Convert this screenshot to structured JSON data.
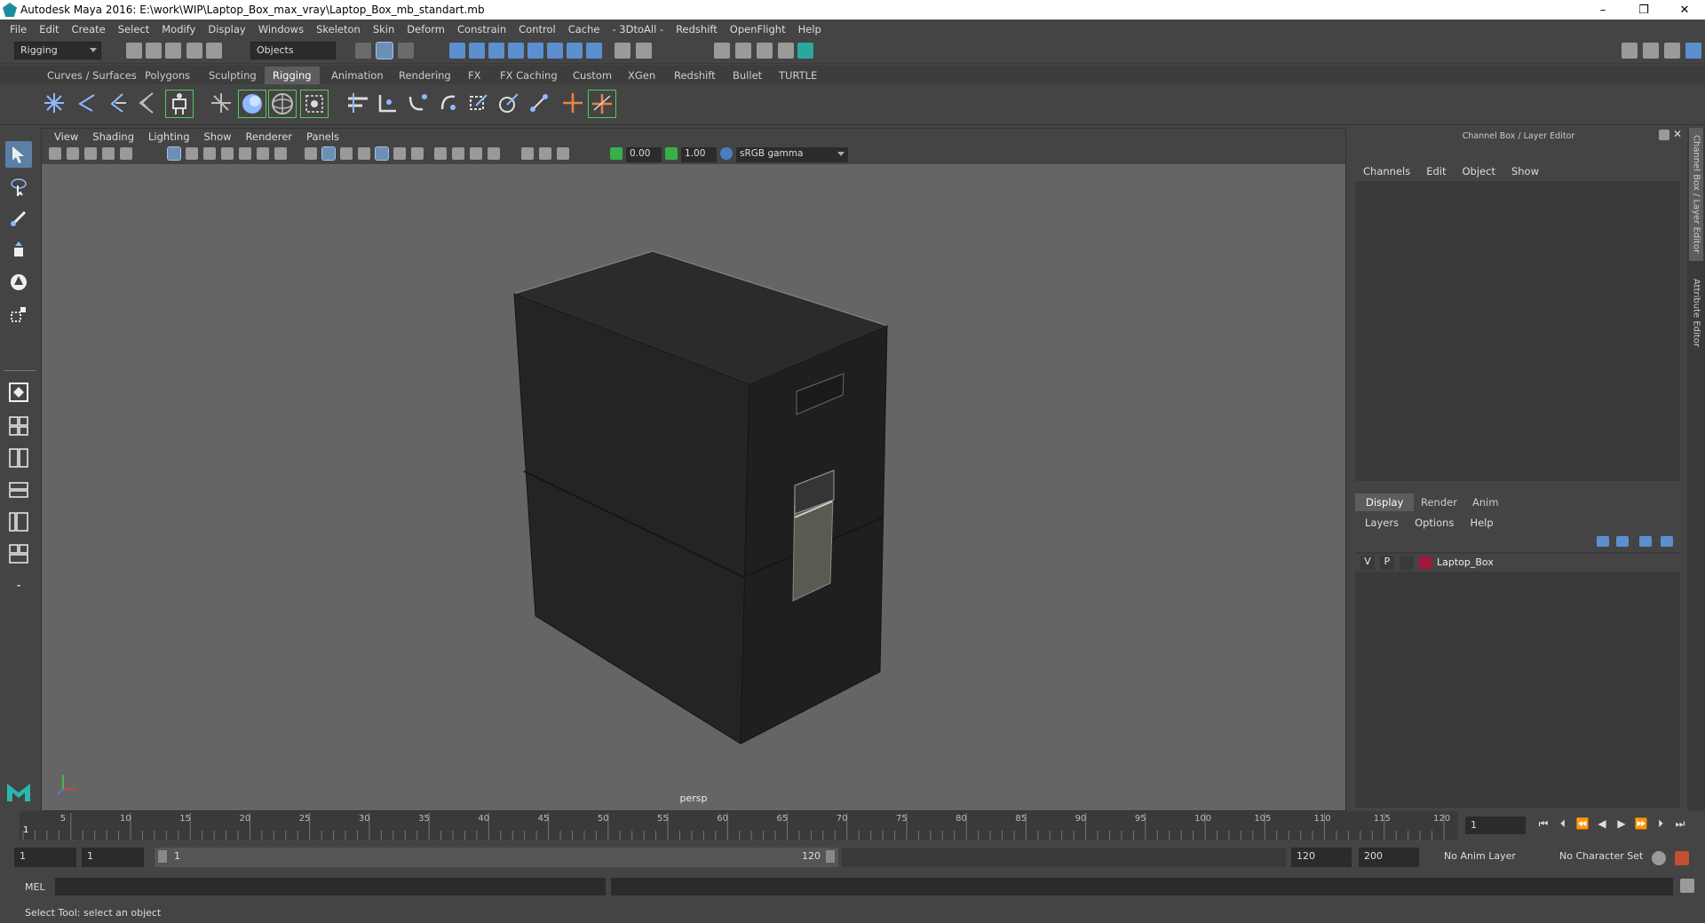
{
  "window": {
    "title": "Autodesk Maya 2016: E:\\work\\WIP\\Laptop_Box_max_vray\\Laptop_Box_mb_standart.mb",
    "controls": [
      "–",
      "❐",
      "✕"
    ]
  },
  "menubar": [
    "File",
    "Edit",
    "Create",
    "Select",
    "Modify",
    "Display",
    "Windows",
    "Skeleton",
    "Skin",
    "Deform",
    "Constrain",
    "Control",
    "Cache",
    "- 3DtoAll -",
    "Redshift",
    "OpenFlight",
    "Help"
  ],
  "statusline": {
    "mode": "Rigging",
    "selection_mode": "Objects"
  },
  "shelf_tabs": [
    "Curves / Surfaces",
    "Polygons",
    "Sculpting",
    "Rigging",
    "Animation",
    "Rendering",
    "FX",
    "FX Caching",
    "Custom",
    "XGen",
    "Redshift",
    "Bullet",
    "TURTLE"
  ],
  "active_shelf_tab": "Rigging",
  "viewport": {
    "menu": [
      "View",
      "Shading",
      "Lighting",
      "Show",
      "Renderer",
      "Panels"
    ],
    "near_value": "0.00",
    "far_value": "1.00",
    "color_space": "sRGB gamma",
    "camera_label": "persp"
  },
  "channel_box": {
    "title": "Channel Box / Layer Editor",
    "menu": [
      "Channels",
      "Edit",
      "Object",
      "Show"
    ],
    "layer_tabs": [
      "Display",
      "Render",
      "Anim"
    ],
    "layer_menu": [
      "Layers",
      "Options",
      "Help"
    ],
    "layer": {
      "v": "V",
      "p": "P",
      "name": "Laptop_Box",
      "color": "#a0173a"
    }
  },
  "side_tabs": [
    "Channel Box / Layer Editor",
    "Attribute Editor"
  ],
  "timeline": {
    "ticks": [
      "5",
      "10",
      "15",
      "20",
      "25",
      "30",
      "35",
      "40",
      "45",
      "50",
      "55",
      "60",
      "65",
      "70",
      "75",
      "80",
      "85",
      "90",
      "95",
      "100",
      "105",
      "110",
      "115",
      "120"
    ],
    "first_frame": "1",
    "current_frame": "1"
  },
  "range": {
    "start": "1",
    "playback_start": "1",
    "slider_start": "1",
    "slider_end": "120",
    "playback_end": "120",
    "end": "200",
    "anim_layer": "No Anim Layer",
    "character_set": "No Character Set"
  },
  "command_line": {
    "label": "MEL"
  },
  "help_line": "Select Tool: select an object"
}
